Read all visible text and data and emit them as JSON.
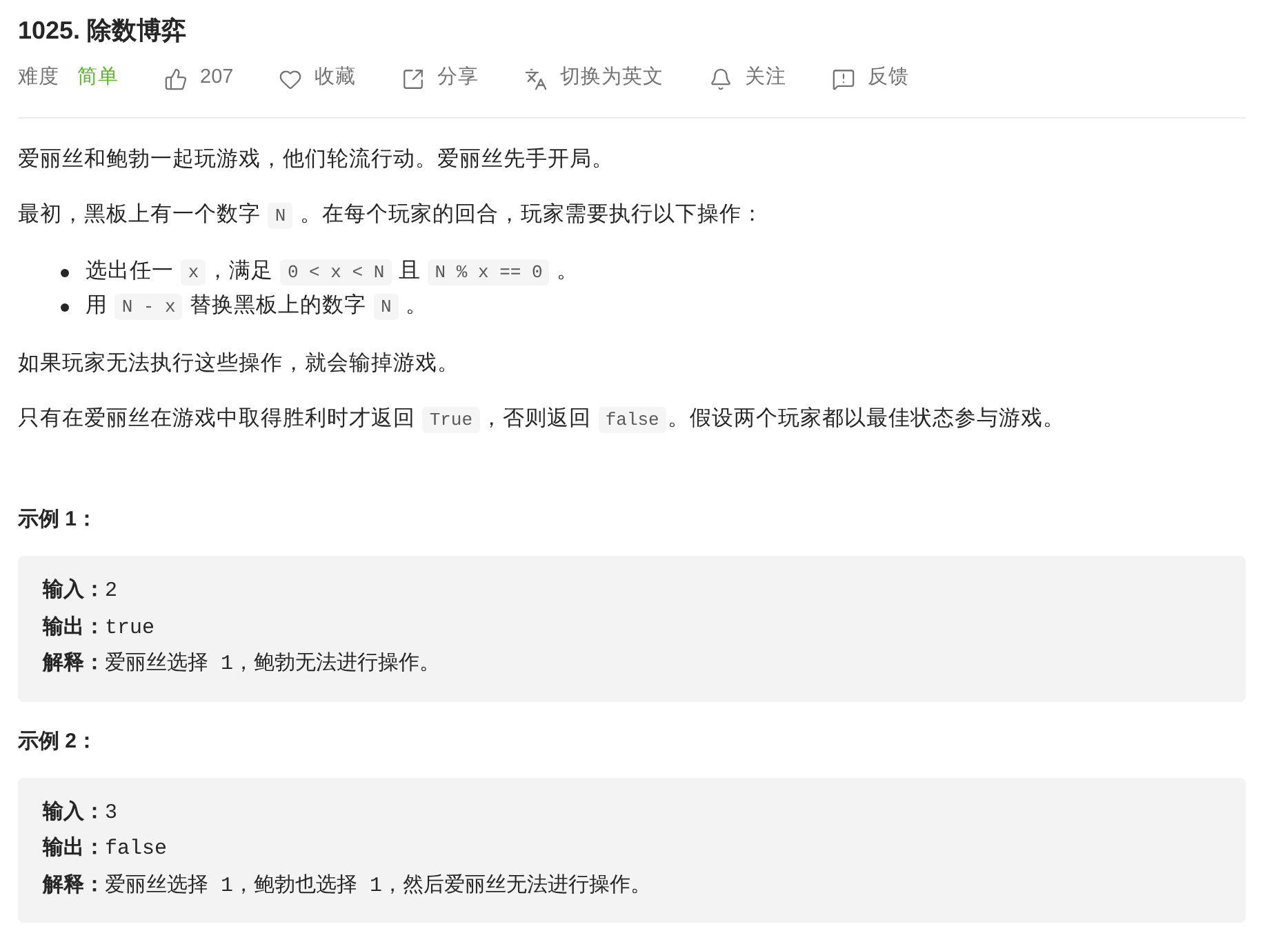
{
  "title": "1025. 除数博弈",
  "meta": {
    "difficulty_label": "难度",
    "difficulty": "简单",
    "actions": [
      {
        "kind": "like",
        "label": "207"
      },
      {
        "kind": "favorite",
        "label": "收藏"
      },
      {
        "kind": "share",
        "label": "分享"
      },
      {
        "kind": "translate",
        "label": "切换为英文"
      },
      {
        "kind": "follow",
        "label": "关注"
      },
      {
        "kind": "feedback",
        "label": "反馈"
      }
    ]
  },
  "description": [
    {
      "kind": "paragraph",
      "parts": [
        {
          "kind": "text",
          "text": "爱丽丝和鲍勃一起玩游戏，他们轮流行动。爱丽丝先手开局。"
        }
      ]
    },
    {
      "kind": "paragraph",
      "parts": [
        {
          "kind": "text",
          "text": "最初，黑板上有一个数字 "
        },
        {
          "kind": "code",
          "text": "N"
        },
        {
          "kind": "text",
          "text": " 。在每个玩家的回合，玩家需要执行以下操作："
        }
      ]
    },
    {
      "kind": "list",
      "items": [
        {
          "parts": [
            {
              "kind": "text",
              "text": "选出任一 "
            },
            {
              "kind": "code",
              "text": "x"
            },
            {
              "kind": "text",
              "text": "，满足 "
            },
            {
              "kind": "code",
              "text": "0 < x < N"
            },
            {
              "kind": "text",
              "text": " 且 "
            },
            {
              "kind": "code",
              "text": "N % x == 0"
            },
            {
              "kind": "text",
              "text": " 。"
            }
          ]
        },
        {
          "parts": [
            {
              "kind": "text",
              "text": "用 "
            },
            {
              "kind": "code",
              "text": "N - x"
            },
            {
              "kind": "text",
              "text": " 替换黑板上的数字 "
            },
            {
              "kind": "code",
              "text": "N"
            },
            {
              "kind": "text",
              "text": " 。"
            }
          ]
        }
      ]
    },
    {
      "kind": "paragraph",
      "parts": [
        {
          "kind": "text",
          "text": "如果玩家无法执行这些操作，就会输掉游戏。"
        }
      ]
    },
    {
      "kind": "paragraph",
      "parts": [
        {
          "kind": "text",
          "text": "只有在爱丽丝在游戏中取得胜利时才返回 "
        },
        {
          "kind": "code",
          "text": "True"
        },
        {
          "kind": "text",
          "text": "，否则返回 "
        },
        {
          "kind": "code",
          "text": "false"
        },
        {
          "kind": "text",
          "text": "。假设两个玩家都以最佳状态参与游戏。"
        }
      ]
    }
  ],
  "examples": [
    {
      "title": "示例 1：",
      "lines": [
        {
          "label": "输入：",
          "value": "2"
        },
        {
          "label": "输出：",
          "value": "true"
        },
        {
          "label": "解释：",
          "value": "爱丽丝选择 1，鲍勃无法进行操作。"
        }
      ]
    },
    {
      "title": "示例 2：",
      "lines": [
        {
          "label": "输入：",
          "value": "3"
        },
        {
          "label": "输出：",
          "value": "false"
        },
        {
          "label": "解释：",
          "value": "爱丽丝选择 1，鲍勃也选择 1，然后爱丽丝无法进行操作。"
        }
      ]
    }
  ]
}
